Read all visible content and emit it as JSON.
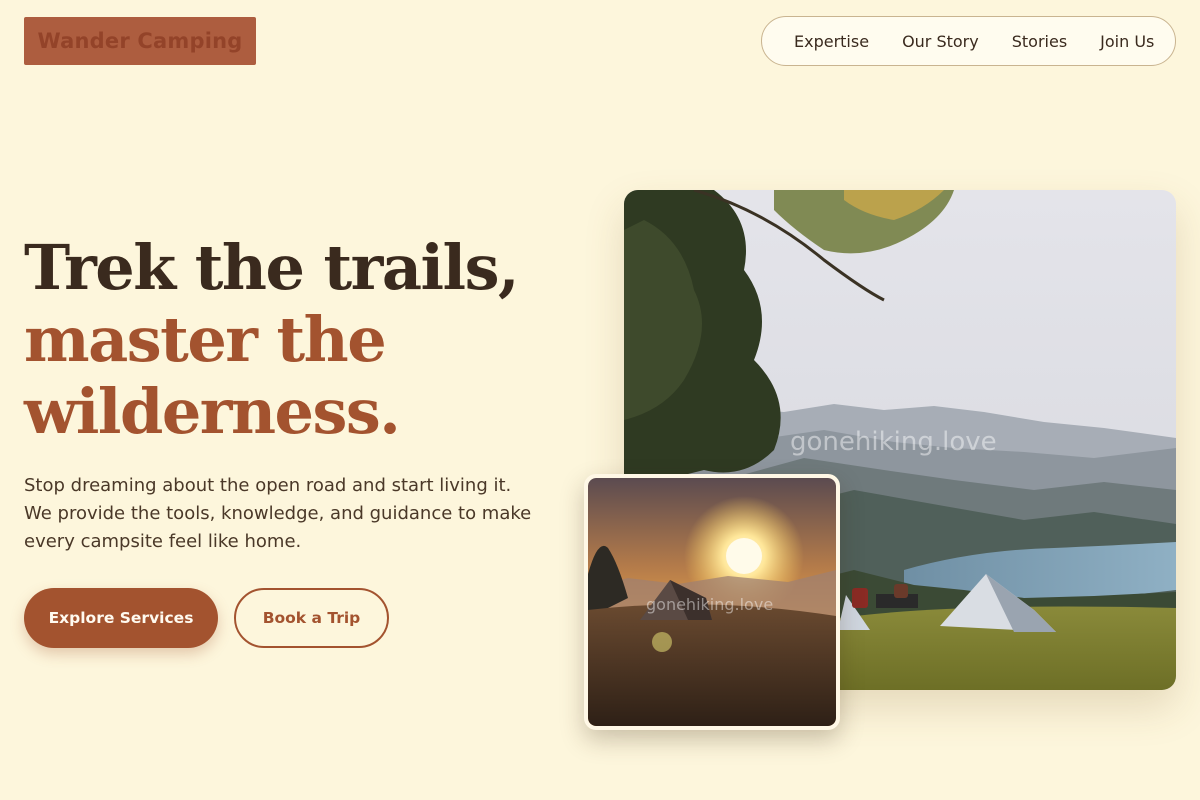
{
  "brand": {
    "name": "Wander Camping",
    "color": "#ad5d3f"
  },
  "nav": {
    "items": [
      {
        "label": "Expertise"
      },
      {
        "label": "Our Story"
      },
      {
        "label": "Stories"
      },
      {
        "label": "Join Us"
      }
    ]
  },
  "hero": {
    "headline_line1": "Trek the trails,",
    "headline_line2": "master the",
    "headline_line3": "wilderness.",
    "description": "Stop dreaming about the open road and start living it. We provide the tools, knowledge, and guidance to make every campsite feel like home.",
    "primary_cta": "Explore Services",
    "secondary_cta": "Book a Trip"
  },
  "images": {
    "main": {
      "subject": "mountain-lake-campsite-photo",
      "watermark": "gonehiking.love"
    },
    "secondary": {
      "subject": "sunset-tent-photo",
      "watermark": "gonehiking.love"
    }
  },
  "colors": {
    "background": "#fdf6dc",
    "text_dark": "#3a2a1e",
    "accent": "#a3532f",
    "nav_border": "#c9b490"
  }
}
